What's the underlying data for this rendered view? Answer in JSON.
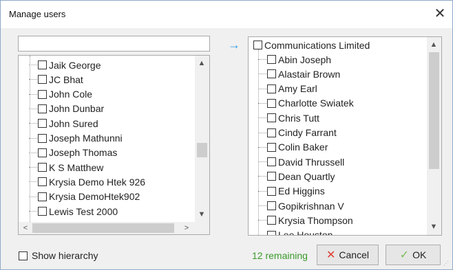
{
  "window": {
    "title": "Manage users",
    "close_glyph": "✕"
  },
  "search": {
    "value": "",
    "placeholder": ""
  },
  "transfer_arrow": "→",
  "left_list": {
    "items": [
      "Jaik George",
      "JC Bhat",
      "John Cole",
      "John Dunbar",
      "John Sured",
      "Joseph Mathunni",
      "Joseph Thomas",
      "K S Matthew",
      "Krysia Demo Htek 926",
      "Krysia DemoHtek902",
      "Lewis Test 2000"
    ],
    "scroll_up": "▲",
    "scroll_down": "▼",
    "scroll_left": "<",
    "scroll_right": ">"
  },
  "right_list": {
    "root": "Communications Limited",
    "items": [
      "Abin Joseph",
      "Alastair Brown",
      "Amy Earl",
      "Charlotte Swiatek",
      "Chris Tutt",
      "Cindy Farrant",
      "Colin Baker",
      "David Thrussell",
      "Dean Quartly",
      "Ed Higgins",
      "Gopikrishnan V",
      "Krysia Thompson",
      "Lee Houston"
    ],
    "scroll_up": "▲",
    "scroll_down": "▼"
  },
  "footer": {
    "show_hierarchy_label": "Show hierarchy",
    "show_hierarchy_checked": false,
    "remaining_text": "12 remaining",
    "cancel_label": "Cancel",
    "ok_label": "OK",
    "cancel_icon": "✕",
    "ok_icon": "✓"
  },
  "colors": {
    "accent_arrow": "#2b9be8",
    "remaining_green": "#3a9a2a",
    "cancel_red": "#e03c31",
    "ok_green": "#7dbb57"
  }
}
